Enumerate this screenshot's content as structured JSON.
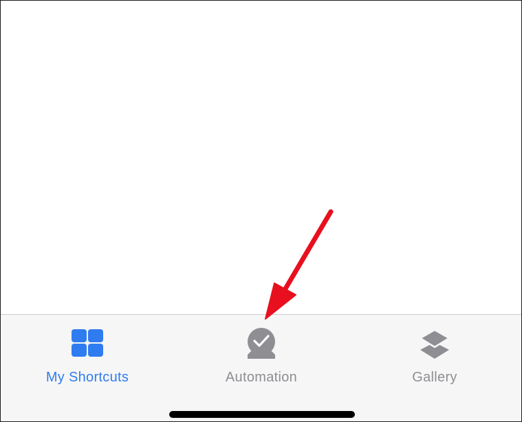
{
  "tab_bar": {
    "tabs": [
      {
        "label": "My Shortcuts",
        "icon": "grid-icon",
        "state": "selected"
      },
      {
        "label": "Automation",
        "icon": "clock-check-icon",
        "state": "unselected"
      },
      {
        "label": "Gallery",
        "icon": "layers-icon",
        "state": "unselected"
      }
    ]
  },
  "colors": {
    "accent": "#2f7cf0",
    "inactive": "#8e8e93",
    "tab_bar_background": "#f6f6f6",
    "annotation_arrow": "#e8101e"
  }
}
